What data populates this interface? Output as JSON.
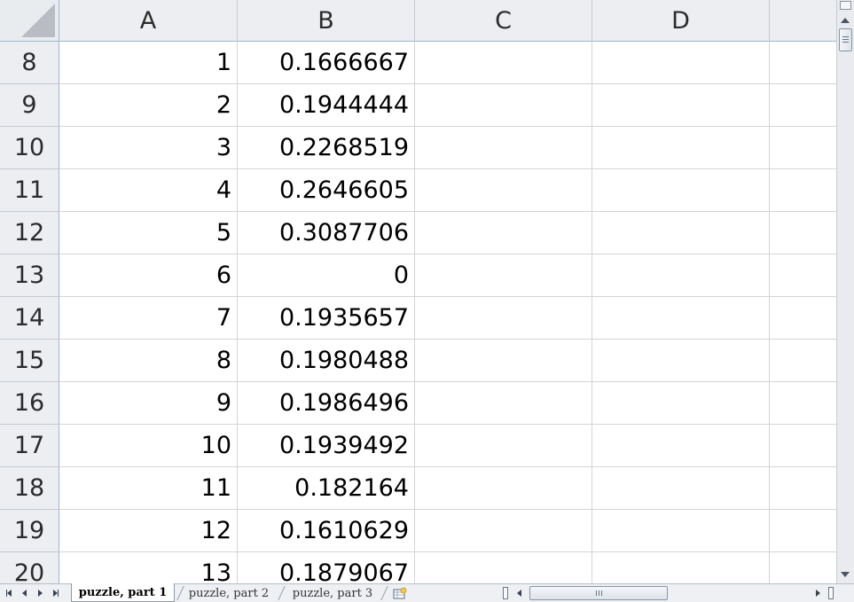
{
  "columns": [
    "A",
    "B",
    "C",
    "D",
    ""
  ],
  "rows": [
    {
      "num": "8",
      "a": "1",
      "b": "0.1666667"
    },
    {
      "num": "9",
      "a": "2",
      "b": "0.1944444"
    },
    {
      "num": "10",
      "a": "3",
      "b": "0.2268519"
    },
    {
      "num": "11",
      "a": "4",
      "b": "0.2646605"
    },
    {
      "num": "12",
      "a": "5",
      "b": "0.3087706"
    },
    {
      "num": "13",
      "a": "6",
      "b": "0"
    },
    {
      "num": "14",
      "a": "7",
      "b": "0.1935657"
    },
    {
      "num": "15",
      "a": "8",
      "b": "0.1980488"
    },
    {
      "num": "16",
      "a": "9",
      "b": "0.1986496"
    },
    {
      "num": "17",
      "a": "10",
      "b": "0.1939492"
    },
    {
      "num": "18",
      "a": "11",
      "b": "0.182164"
    },
    {
      "num": "19",
      "a": "12",
      "b": "0.1610629"
    },
    {
      "num": "20",
      "a": "13",
      "b": "0.1879067"
    }
  ],
  "sheets": {
    "active": "puzzle, part 1",
    "tab2": "puzzle, part 2",
    "tab3": "puzzle, part 3"
  },
  "icons": {
    "first": "first-sheet-icon",
    "prev": "previous-sheet-icon",
    "next": "next-sheet-icon",
    "last": "last-sheet-icon",
    "insert": "insert-sheet-icon"
  },
  "colors": {
    "header_bg": "#eceef2",
    "header_border": "#9eb6ce",
    "gridline": "#d4d4d4"
  }
}
